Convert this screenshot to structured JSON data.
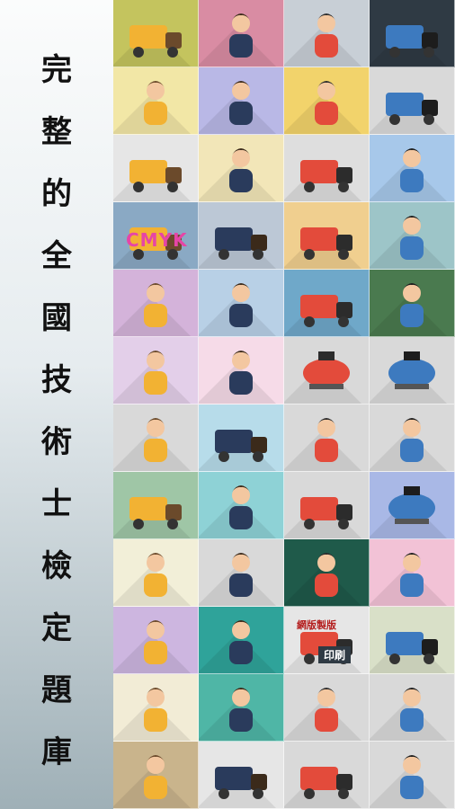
{
  "sidebar": {
    "title_chars": [
      "完",
      "整",
      "的",
      "全",
      "國",
      "技",
      "術",
      "士",
      "檢",
      "定",
      "題",
      "庫"
    ]
  },
  "grid": {
    "tiles": [
      {
        "icon": "crane-truck-icon",
        "bg": "#c4c45e"
      },
      {
        "icon": "hairdresser-icon",
        "bg": "#d98ca3"
      },
      {
        "icon": "car-mechanic-icon",
        "bg": "#c8cfd6"
      },
      {
        "icon": "car-lift-icon",
        "bg": "#2f3a44"
      },
      {
        "icon": "business-man-icon",
        "bg": "#f2e7a6"
      },
      {
        "icon": "presenter-icon",
        "bg": "#b9b8e6"
      },
      {
        "icon": "barber-icon",
        "bg": "#f2d36b"
      },
      {
        "icon": "car-repair-icon",
        "bg": "#d9d9d9"
      },
      {
        "icon": "printer-machine-icon",
        "bg": "#e6e6e6"
      },
      {
        "icon": "massage-bed-icon",
        "bg": "#f2e6b8"
      },
      {
        "icon": "scaffold-icon",
        "bg": "#dedede"
      },
      {
        "icon": "caregiver-icon",
        "bg": "#a7c8ea"
      },
      {
        "icon": "cmyk-print-icon",
        "bg": "#8aa9c4"
      },
      {
        "icon": "air-conditioner-icon",
        "bg": "#bcc8d6"
      },
      {
        "icon": "jewelry-box-icon",
        "bg": "#f0cf8f"
      },
      {
        "icon": "bakery-counter-icon",
        "bg": "#9dc5c8"
      },
      {
        "icon": "nanny-stroller-icon",
        "bg": "#d4b3da"
      },
      {
        "icon": "wall-painter-icon",
        "bg": "#b8d0e6"
      },
      {
        "icon": "control-panel-icon",
        "bg": "#6fa8c9"
      },
      {
        "icon": "boiler-engineer-icon",
        "bg": "#4a7a4f"
      },
      {
        "icon": "yoga-instructor-icon",
        "bg": "#e3cfe9"
      },
      {
        "icon": "facial-spa-icon",
        "bg": "#f6dbe8"
      },
      {
        "icon": "pump-valve-icon",
        "bg": "#d9d9d9"
      },
      {
        "icon": "money-tanker-icon",
        "bg": "#d9d9d9"
      },
      {
        "icon": "factory-worker-icon",
        "bg": "#d9d9d9"
      },
      {
        "icon": "forklift-icon",
        "bg": "#b7dcea"
      },
      {
        "icon": "wheelbarrow-worker-icon",
        "bg": "#d9d9d9"
      },
      {
        "icon": "vr-goggles-icon",
        "bg": "#d9d9d9"
      },
      {
        "icon": "bulldozer-icon",
        "bg": "#9fc6a6"
      },
      {
        "icon": "waiter-icon",
        "bg": "#8ed2d6"
      },
      {
        "icon": "mobile-crane-icon",
        "bg": "#d9d9d9"
      },
      {
        "icon": "water-tank-icon",
        "bg": "#a9b8e6"
      },
      {
        "icon": "gardener-icon",
        "bg": "#f2efd8"
      },
      {
        "icon": "woodworker-icon",
        "bg": "#d9d9d9"
      },
      {
        "icon": "farmer-icon",
        "bg": "#1f5a4a"
      },
      {
        "icon": "sewing-icon",
        "bg": "#f2c2d6"
      },
      {
        "icon": "draftsman-icon",
        "bg": "#cdb6e0"
      },
      {
        "icon": "tailor-icon",
        "bg": "#2fa39a"
      },
      {
        "icon": "printing-press-icon",
        "bg": "#e6e6e6"
      },
      {
        "icon": "laundry-machine-icon",
        "bg": "#d9e0c8"
      },
      {
        "icon": "accountant-icon",
        "bg": "#f2ecd6"
      },
      {
        "icon": "elderly-care-icon",
        "bg": "#4fb6a6"
      },
      {
        "icon": "carpenter-icon",
        "bg": "#d9d9d9"
      },
      {
        "icon": "welder-icon",
        "bg": "#d9d9d9"
      },
      {
        "icon": "miner-icon",
        "bg": "#c9b48c"
      },
      {
        "icon": "farm-field-icon",
        "bg": "#e6e6e6"
      },
      {
        "icon": "bicycle-repair-icon",
        "bg": "#d9d9d9"
      },
      {
        "icon": "electrician-pole-icon",
        "bg": "#d9d9d9"
      }
    ],
    "printing_label_top": "網版製版",
    "printing_label_bottom": "印刷",
    "cmyk_label": "CMYK"
  }
}
